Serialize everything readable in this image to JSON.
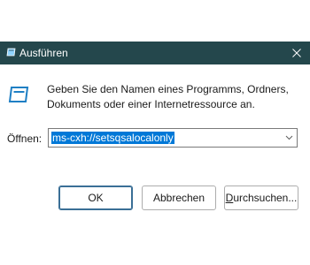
{
  "window": {
    "title": "Ausführen",
    "close_glyph": "✕"
  },
  "message": {
    "line1": "Geben Sie den Namen eines Programms, Ordners,",
    "line2": "Dokuments oder einer Internetressource an."
  },
  "open_field": {
    "label": "Öffnen:",
    "value": "ms-cxh://setsqsalocalonly"
  },
  "buttons": {
    "ok": "OK",
    "cancel": "Abbrechen",
    "browse_first": "D",
    "browse_rest": "urchsuchen..."
  },
  "colors": {
    "titlebar": "#24474c",
    "selection": "#0078d7"
  }
}
